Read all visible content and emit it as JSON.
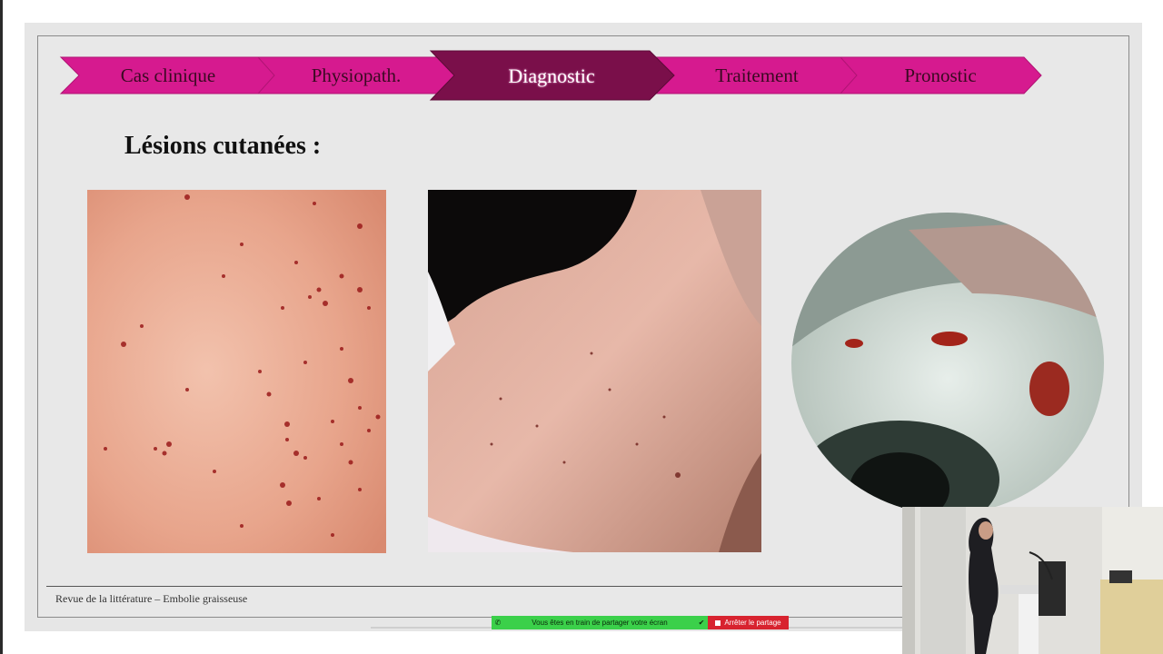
{
  "nav": {
    "steps": [
      {
        "label": "Cas clinique"
      },
      {
        "label": "Physiopath."
      },
      {
        "label": "Diagnostic"
      },
      {
        "label": "Traitement"
      },
      {
        "label": "Pronostic"
      }
    ],
    "active_index": 2,
    "colors": {
      "step": "#d61a8f",
      "active": "#7a0f4a"
    }
  },
  "slide": {
    "title": "Lésions cutanées :",
    "footer": "Revue de la littérature – Embolie graisseuse"
  },
  "screen_share": {
    "message": "Vous êtes en train de partager votre écran",
    "stop_label": "Arrêter le partage",
    "bar_color": "#3bd04a",
    "stop_color": "#d8232f"
  },
  "icons": {
    "share_left": "phone-icon",
    "share_right": "shield-check-icon",
    "stop": "stop-square-icon"
  }
}
